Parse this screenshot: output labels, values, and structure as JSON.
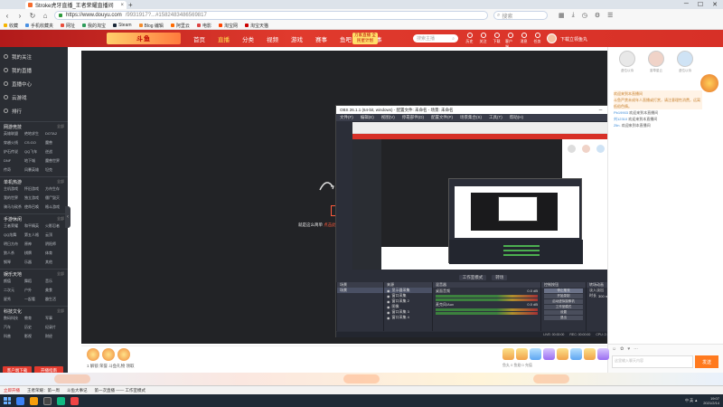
{
  "browser": {
    "tab_title": "Stroke虎牙直播_王者荣耀直播间",
    "url_host": "https://www.douyu.com",
    "url_path": "/9931917?...#1582483486569817",
    "search_placeholder": "搜索",
    "bookmarks": [
      "收藏",
      "手机收藏夹",
      "网址",
      "我的淘宝",
      "Steam",
      "Blog 编辑",
      "阿里云",
      "电影",
      "淘宝网",
      "淘宝天猫"
    ]
  },
  "site": {
    "logo_text": "斗鱼",
    "nav": [
      "首页",
      "直播",
      "分类",
      "视频",
      "游戏",
      "赛事",
      "鱼吧",
      "大赛事"
    ],
    "promo": "万家直播 全民星计划",
    "search_placeholder": "搜索主播",
    "header_icons": [
      "历史",
      "关注",
      "下载",
      "客户端",
      "消息",
      "任务"
    ],
    "user_text": "下载立领鱼丸"
  },
  "sidebar": {
    "main": [
      "我的关注",
      "我的直播",
      "直播中心",
      "云游戏",
      "排行"
    ],
    "sections": [
      {
        "title": "网游竞技",
        "more": "全部",
        "items": [
          "英雄联盟",
          "绝地求生",
          "DOTA2",
          "穿越火线",
          "CS:GO",
          "魔兽",
          "炉石传说",
          "QQ飞车",
          "逆战",
          "DNF",
          "地下城",
          "魔兽世界",
          "传奇",
          "风暴英雄",
          "坦克"
        ]
      },
      {
        "title": "单机热游",
        "more": "全部",
        "items": [
          "主机游戏",
          "怀旧游戏",
          "方舟生存",
          "我的世界",
          "独立游戏",
          "僵尸毁灭",
          "骑马与砍杀",
          "使命召唤",
          "格斗游戏"
        ]
      },
      {
        "title": "手游休闲",
        "more": "全部",
        "items": [
          "王者荣耀",
          "和平精英",
          "火影忍者",
          "QQ炫舞",
          "第五人格",
          "云顶",
          "明日方舟",
          "原神",
          "阴阳师",
          "狼人杀",
          "棋牌",
          "体育",
          "钢琴",
          "乐器",
          "其他"
        ]
      },
      {
        "title": "娱乐天地",
        "more": "全部",
        "items": [
          "颜值",
          "舞蹈",
          "音乐",
          "二次元",
          "户外",
          "美食",
          "星秀",
          "一起看",
          "趣生活"
        ]
      },
      {
        "title": "科技文化",
        "more": "全部",
        "items": [
          "数码科技",
          "教育",
          "军事",
          "汽车",
          "历史",
          "纪录片",
          "科普",
          "影视",
          "财经"
        ]
      }
    ],
    "footer_buttons": [
      "客户端下载",
      "开播指南"
    ]
  },
  "player": {
    "hint_prefix": "就是这么简单",
    "hint_link": "点击此处开播",
    "hint_suffix": "马上体验一下"
  },
  "obs": {
    "title": "OBS 26.1.1 (64-bit, windows) - 配置文件: 未命名 - 场景: 未命名",
    "menu": [
      "文件(F)",
      "编辑(E)",
      "视图(V)",
      "停靠部件(D)",
      "配置文件(P)",
      "场景集合(S)",
      "工具(T)",
      "帮助(H)"
    ],
    "modes": [
      "工作室模式",
      "转场"
    ],
    "docks": {
      "scenes_title": "场景",
      "scenes": [
        "场景"
      ],
      "sources_title": "来源",
      "sources": [
        "显示器采集",
        "窗口采集",
        "窗口采集 2",
        "图像",
        "窗口采集 3",
        "窗口采集 4"
      ],
      "mixer_title": "混音器",
      "mixer": [
        {
          "name": "桌面音频",
          "level": "0.0 dB"
        },
        {
          "name": "麦克风/Aux",
          "level": "0.0 dB"
        }
      ],
      "transitions_title": "转场动画",
      "transition": "淡入淡出",
      "duration_label": "时长",
      "duration": "300 ms",
      "controls_title": "控制按钮",
      "controls": [
        "停止推流",
        "开始录制",
        "启动虚拟摄像机",
        "工作室模式",
        "设置",
        "退出"
      ]
    },
    "status": [
      "LIVE: 00:00:00",
      "REC: 00:00:00",
      "CPU: 2.9%, 60.00 fps"
    ]
  },
  "chat": {
    "rank_names": [
      "虚位以待",
      "香草星云",
      "虚位以待"
    ],
    "messages": [
      {
        "type": "sys",
        "name": "",
        "text": "欢迎来到本直播间"
      },
      {
        "type": "sys",
        "name": "",
        "text": "斗鱼严禁未成年人直播或打赏，请注意理性消费，远离低俗色情。"
      },
      {
        "type": "user",
        "name": "Pb19903",
        "text": "欢迎来到本直播间"
      },
      {
        "type": "user",
        "name": "刘12310",
        "text": "欢迎来到本直播间"
      },
      {
        "type": "user",
        "name": "Ziin.",
        "text": "欢迎来到本直播间"
      }
    ],
    "input_placeholder": "这里输入聊天内容",
    "send_label": "发送"
  },
  "giftstrip": {
    "caption": "1 解锁 荣誉 斗鱼礼物 领取",
    "sub": "鱼丸 0   鱼翅 0   充值"
  },
  "notice": {
    "items": [
      "立即开播",
      "王者荣耀：第一周",
      "斗鱼大事记",
      "第一次直播 —— 工作室模式"
    ]
  },
  "taskbar": {
    "tray": "中 英 ▲",
    "time": "19:07",
    "date": "2021/2/14"
  }
}
